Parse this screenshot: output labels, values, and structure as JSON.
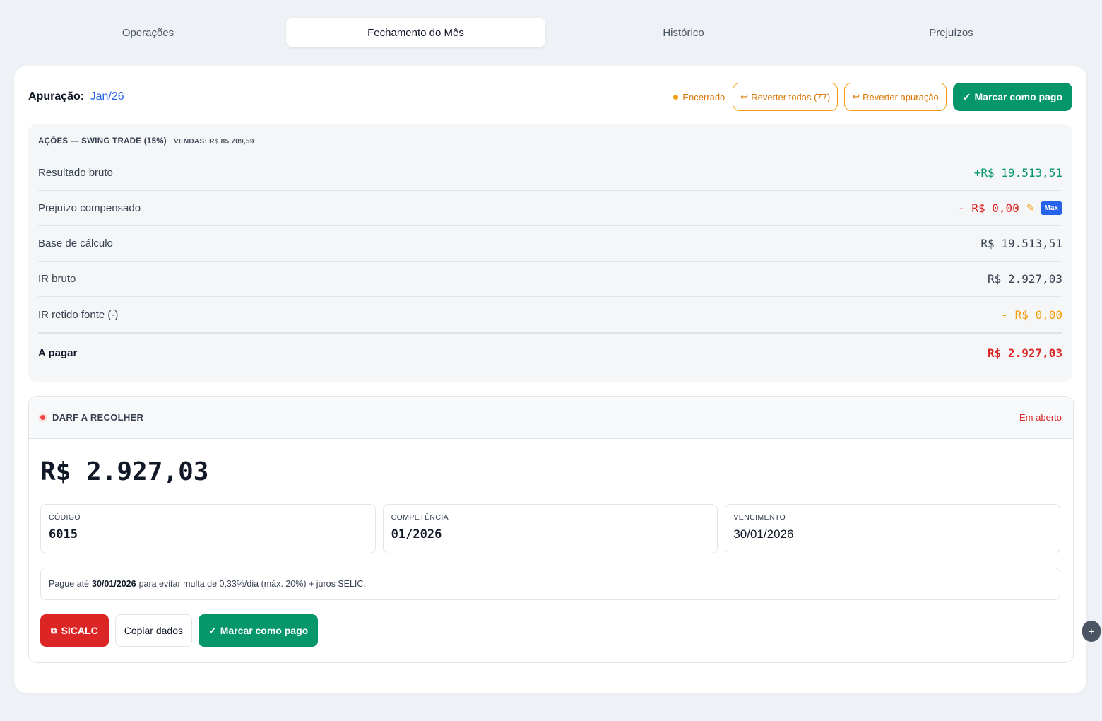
{
  "tabs": [
    {
      "label": "Operações"
    },
    {
      "label": "Fechamento do Mês",
      "active": true
    },
    {
      "label": "Histórico"
    },
    {
      "label": "Prejuízos"
    }
  ],
  "header": {
    "apuracao_label": "Apuração:",
    "period": "Jan/26",
    "status": "Encerrado",
    "revert_all_label": "Reverter todas (77)",
    "revert_label": "Reverter apuração",
    "mark_paid_label": "Marcar como pago"
  },
  "summary": {
    "title": "AÇÕES — SWING TRADE (15%)",
    "sales": "VENDAS: R$ 85.709,59",
    "rows": [
      {
        "label": "Resultado bruto",
        "value": "+R$ 19.513,51"
      },
      {
        "label": "Prejuízo compensado",
        "value": "- R$ 0,00",
        "badge": "Max"
      },
      {
        "label": "Base de cálculo",
        "value": "R$ 19.513,51"
      },
      {
        "label": "IR bruto",
        "value": "R$ 2.927,03"
      },
      {
        "label": "IR retido fonte (-)",
        "value": "- R$ 0,00"
      },
      {
        "label": "A pagar",
        "value": "R$ 2.927,03"
      }
    ]
  },
  "darf": {
    "title": "DARF A RECOLHER",
    "state": "Em aberto",
    "amount": "R$ 2.927,03",
    "codigo_label": "CÓDIGO",
    "codigo": "6015",
    "competencia_label": "COMPETÊNCIA",
    "competencia": "01/2026",
    "vencimento_label": "VENCIMENTO",
    "vencimento": "30/01/2026",
    "notice_prefix": "Pague até",
    "notice_date": "30/01/2026",
    "notice_suffix": "para evitar multa de 0,33%/dia (máx. 20%) + juros SELIC.",
    "sicalc_label": "SICALC",
    "copy_label": "Copiar dados",
    "mark_paid_label": "Marcar como pago"
  },
  "colors": {
    "accent_green": "#059669",
    "accent_red": "#dc2626",
    "accent_orange": "#f59e0b",
    "link_blue": "#2563eb"
  },
  "icons": {
    "revert": "undo-arrow-icon",
    "check": "check-icon",
    "edit": "pencil-icon",
    "external": "external-link-icon",
    "fab": "plus-icon"
  }
}
